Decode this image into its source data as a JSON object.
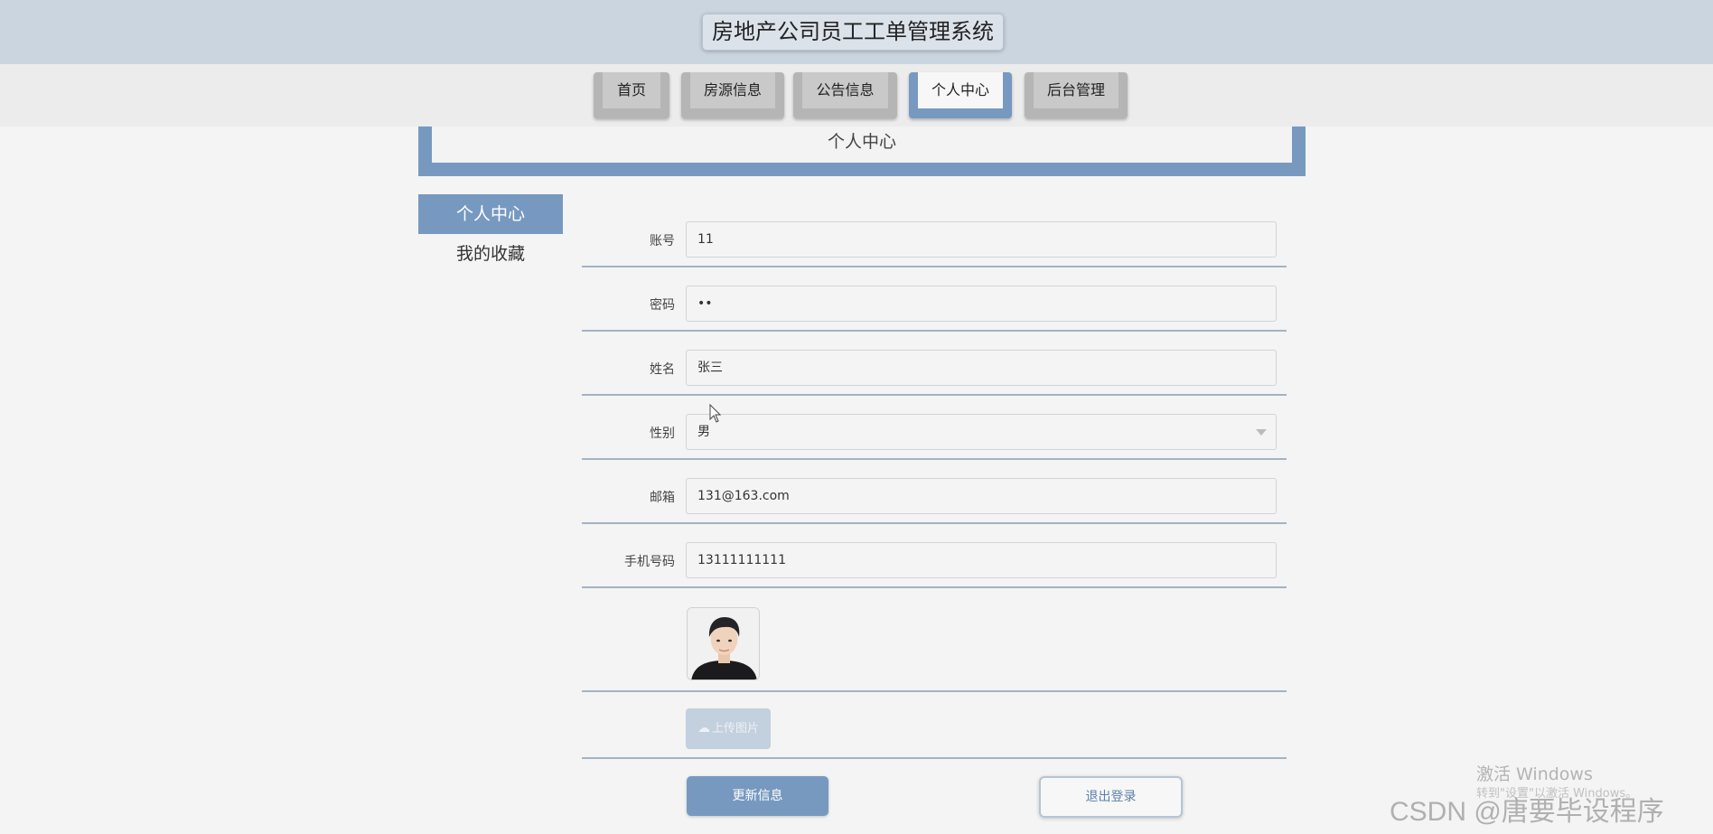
{
  "header": {
    "title": "房地产公司员工工单管理系统"
  },
  "nav": {
    "tabs": [
      {
        "label": "首页"
      },
      {
        "label": "房源信息"
      },
      {
        "label": "公告信息"
      },
      {
        "label": "个人中心",
        "active": true
      },
      {
        "label": "后台管理"
      }
    ]
  },
  "banner": {
    "title": "个人中心"
  },
  "sidebar": {
    "items": [
      {
        "label": "个人中心",
        "active": true
      },
      {
        "label": "我的收藏"
      }
    ]
  },
  "form": {
    "account": {
      "label": "账号",
      "value": "11"
    },
    "password": {
      "label": "密码",
      "value": "••"
    },
    "name": {
      "label": "姓名",
      "value": "张三"
    },
    "gender": {
      "label": "性别",
      "value": "男"
    },
    "email": {
      "label": "邮箱",
      "value": "131@163.com"
    },
    "phone": {
      "label": "手机号码",
      "value": "13111111111"
    },
    "upload_label": "上传图片",
    "update_label": "更新信息",
    "logout_label": "退出登录"
  },
  "watermark": {
    "activate": "激活 Windows",
    "activate_sub": "转到\"设置\"以激活 Windows。",
    "csdn": "CSDN @唐要毕设程序"
  },
  "colors": {
    "accent": "#7799c0",
    "header_bg": "#cbd5df"
  }
}
